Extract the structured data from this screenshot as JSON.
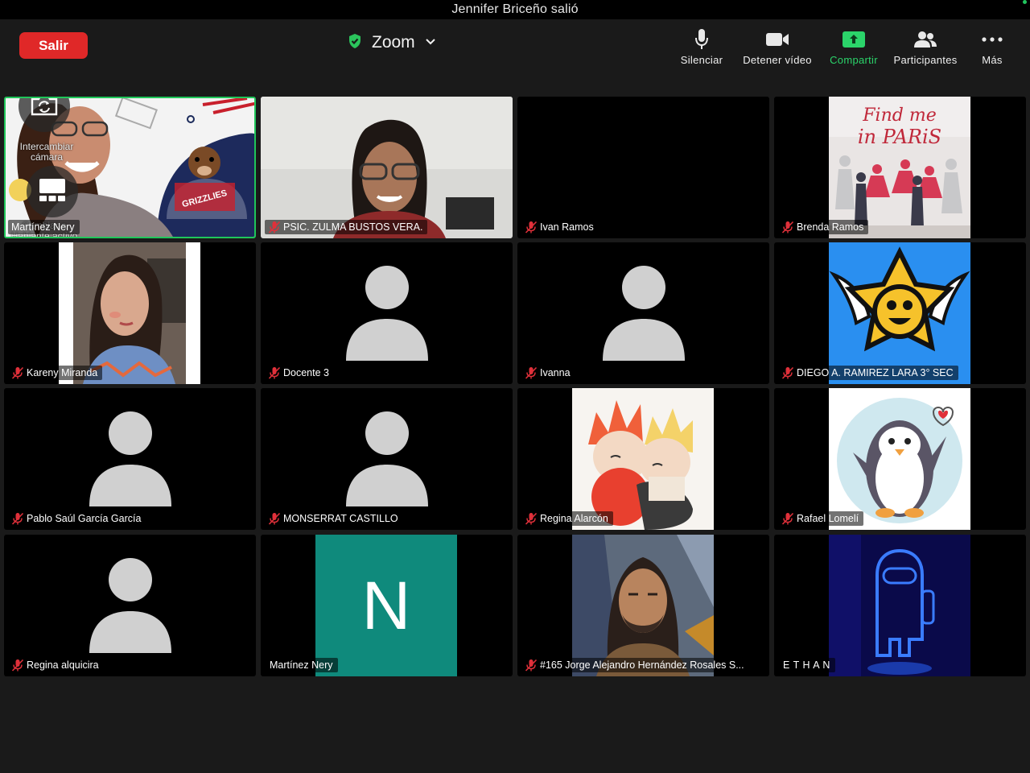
{
  "notification": "Jennifer Briceño salió",
  "toolbar": {
    "leave_label": "Salir",
    "meeting_name": "Zoom",
    "mute_label": "Silenciar",
    "video_label": "Detener vídeo",
    "share_label": "Compartir",
    "participants_label": "Participantes",
    "more_label": "Más"
  },
  "overlay": {
    "switch_camera_label": "Intercambiar cámara",
    "switch_speaker_label": "Cambiar a Hablante activo"
  },
  "participants": [
    {
      "name": "Martínez Nery",
      "muted": false
    },
    {
      "name": "PSIC. ZULMA BUSTOS VERA.",
      "muted": true
    },
    {
      "name": "Ivan  Ramos",
      "muted": true
    },
    {
      "name": "Brenda Ramos",
      "muted": true
    },
    {
      "name": "Kareny Miranda",
      "muted": true
    },
    {
      "name": "Docente 3",
      "muted": true
    },
    {
      "name": "Ivanna",
      "muted": true
    },
    {
      "name": "DIEGO A. RAMIREZ LARA 3° SEC",
      "muted": true
    },
    {
      "name": "Pablo Saúl García García",
      "muted": true
    },
    {
      "name": "MONSERRAT CASTILLO",
      "muted": true
    },
    {
      "name": "Regina Alarcón",
      "muted": true
    },
    {
      "name": "Rafael Lomelí",
      "muted": true
    },
    {
      "name": "Regina alquicira",
      "muted": true
    },
    {
      "name": "Martínez Nery",
      "muted": false
    },
    {
      "name": "#165 Jorge Alejandro Hernández Rosales S...",
      "muted": true
    },
    {
      "name": "E T H A N",
      "muted": false
    }
  ],
  "poster_text": {
    "line1": "Find me",
    "line2": "in PARiS"
  },
  "jersey_text": "GRIZZLIES",
  "initial_letter": "N",
  "colors": {
    "leave": "#e02828",
    "active_border": "#20c65a",
    "share": "#2bd46a",
    "teal_avatar": "#0f8a7c",
    "muted_red": "#e0303a"
  }
}
